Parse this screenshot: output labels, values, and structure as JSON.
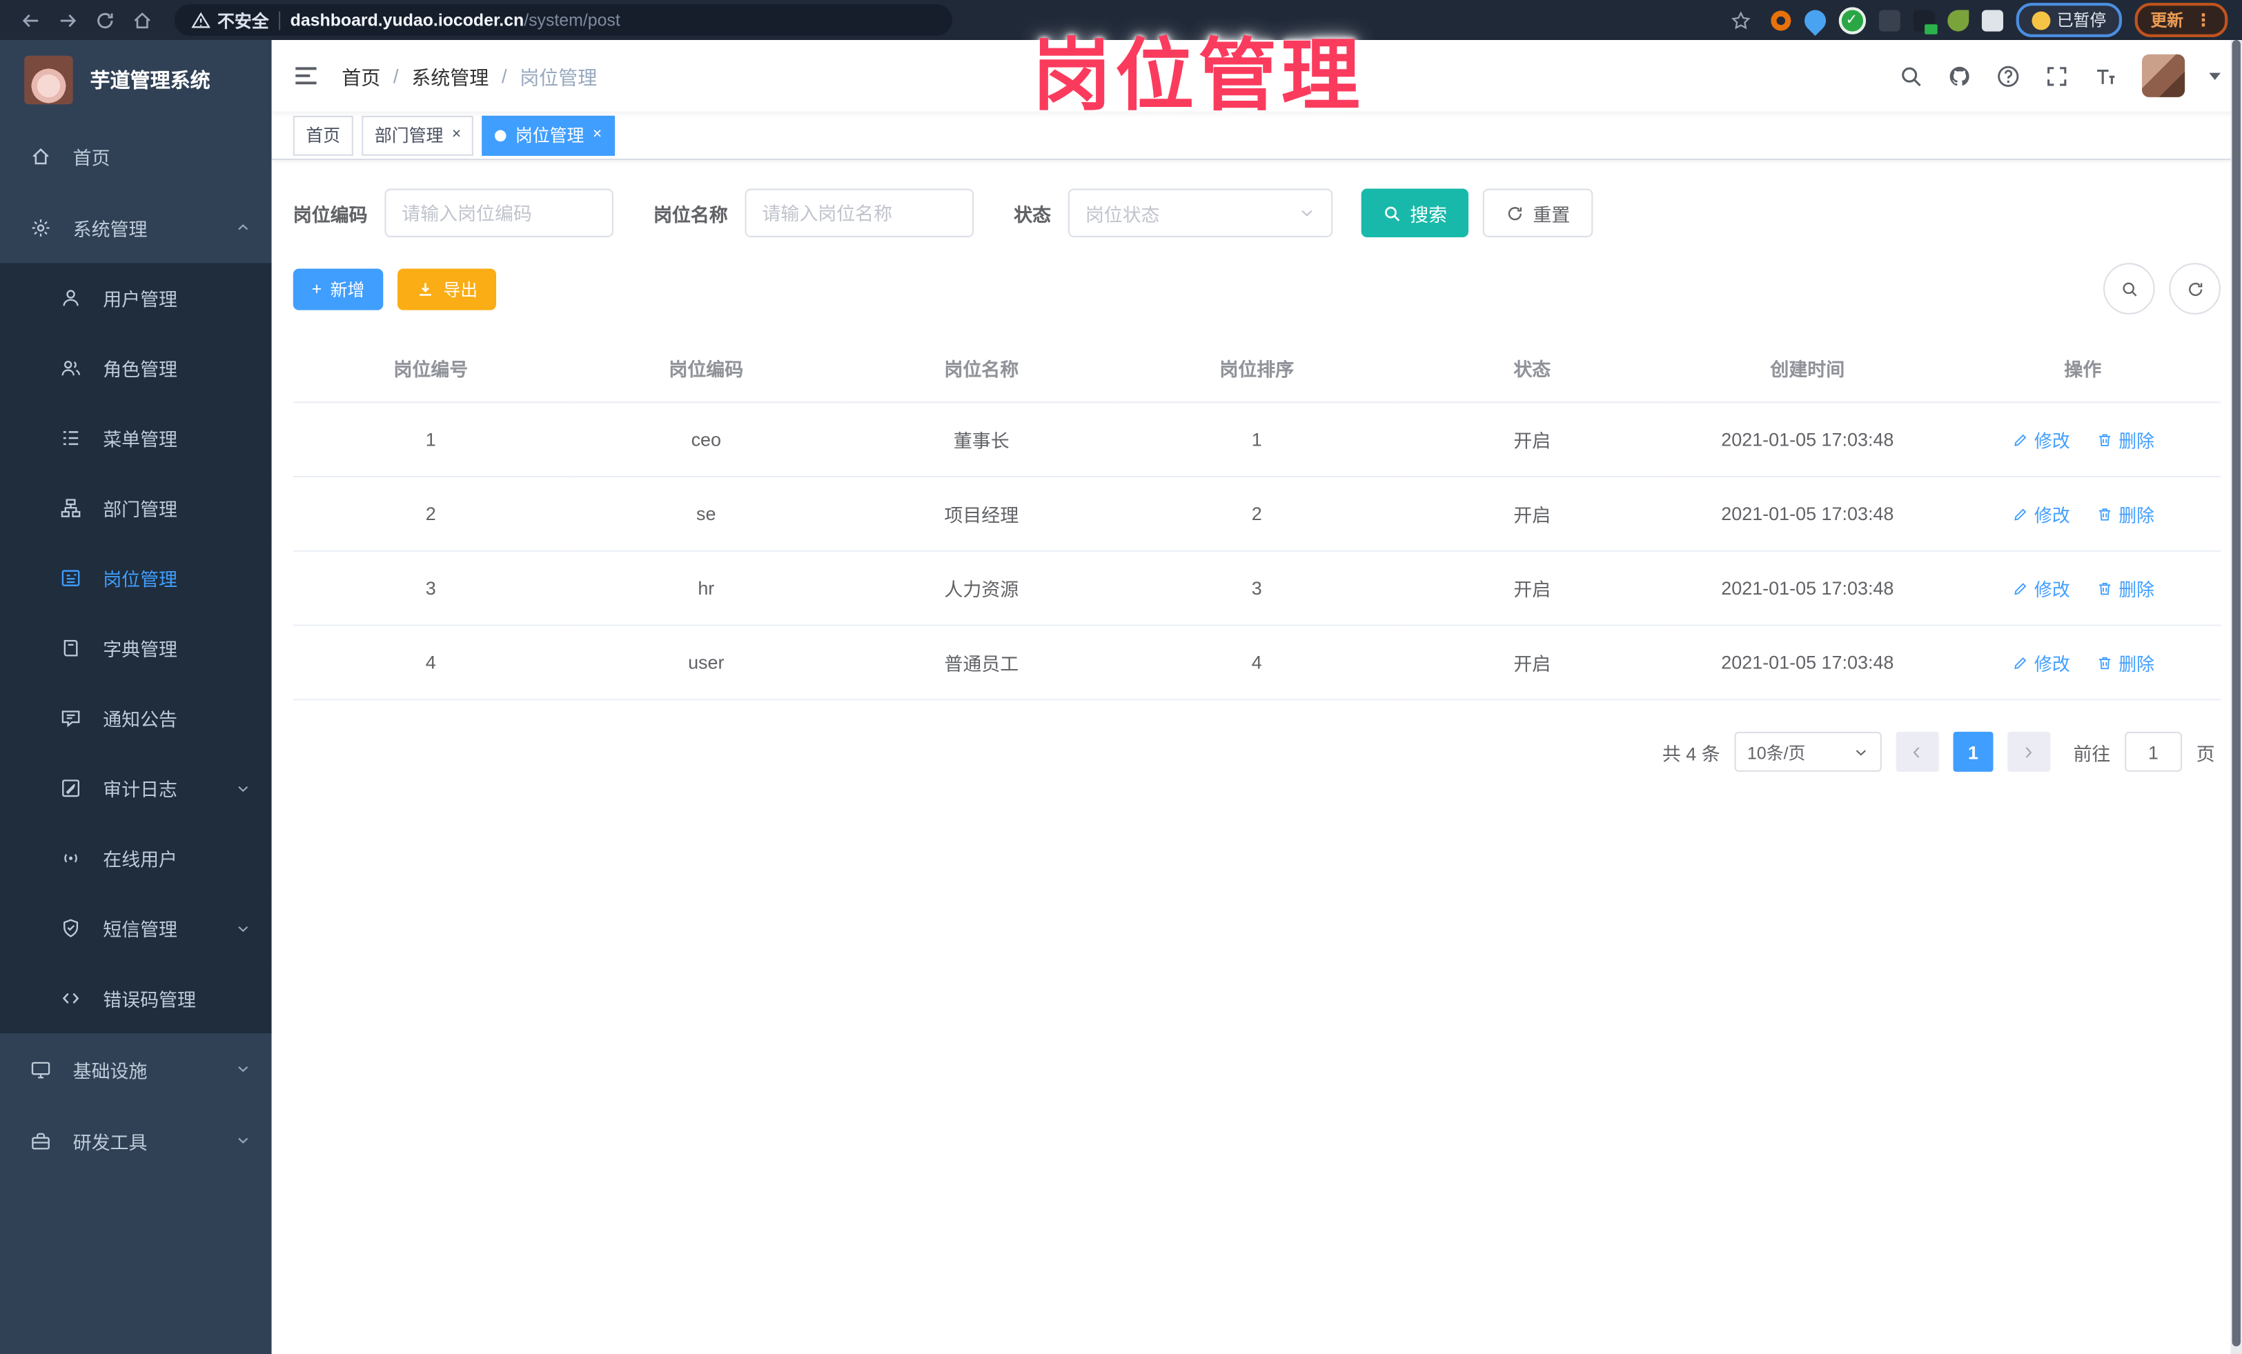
{
  "browser": {
    "security_label": "不安全",
    "url_host": "dashboard.yudao.iocoder.cn",
    "url_path": "/system/post",
    "paused_label": "已暂停",
    "update_label": "更新",
    "kebab": "⋮",
    "extension_icons": [
      "bookmark-star",
      "orange-ring",
      "blue-pin",
      "green-check",
      "gray-sliders",
      "terminal-green",
      "green-leaf",
      "puzzle",
      "paused-smiley"
    ]
  },
  "overlay_title": "岗位管理",
  "sidebar": {
    "app_title": "芋道管理系统",
    "items": [
      {
        "label": "首页"
      },
      {
        "label": "系统管理"
      },
      {
        "label": "用户管理"
      },
      {
        "label": "角色管理"
      },
      {
        "label": "菜单管理"
      },
      {
        "label": "部门管理"
      },
      {
        "label": "岗位管理"
      },
      {
        "label": "字典管理"
      },
      {
        "label": "通知公告"
      },
      {
        "label": "审计日志"
      },
      {
        "label": "在线用户"
      },
      {
        "label": "短信管理"
      },
      {
        "label": "错误码管理"
      },
      {
        "label": "基础设施"
      },
      {
        "label": "研发工具"
      }
    ]
  },
  "breadcrumb": {
    "items": [
      "首页",
      "系统管理",
      "岗位管理"
    ],
    "separator": "/"
  },
  "tags": [
    {
      "label": "首页"
    },
    {
      "label": "部门管理",
      "close": "×"
    },
    {
      "label": "岗位管理",
      "close": "×"
    }
  ],
  "filters": {
    "post_code_label": "岗位编码",
    "post_code_placeholder": "请输入岗位编码",
    "post_name_label": "岗位名称",
    "post_name_placeholder": "请输入岗位名称",
    "status_label": "状态",
    "status_placeholder": "岗位状态",
    "search_label": "搜索",
    "reset_label": "重置"
  },
  "toolbar": {
    "add_label": "新增",
    "add_plus": "+",
    "export_label": "导出"
  },
  "table": {
    "columns": [
      "岗位编号",
      "岗位编码",
      "岗位名称",
      "岗位排序",
      "状态",
      "创建时间",
      "操作"
    ],
    "edit_label": "修改",
    "delete_label": "删除",
    "rows": [
      {
        "no": "1",
        "code": "ceo",
        "name": "董事长",
        "sort": "1",
        "status": "开启",
        "created_at": "2021-01-05 17:03:48"
      },
      {
        "no": "2",
        "code": "se",
        "name": "项目经理",
        "sort": "2",
        "status": "开启",
        "created_at": "2021-01-05 17:03:48"
      },
      {
        "no": "3",
        "code": "hr",
        "name": "人力资源",
        "sort": "3",
        "status": "开启",
        "created_at": "2021-01-05 17:03:48"
      },
      {
        "no": "4",
        "code": "user",
        "name": "普通员工",
        "sort": "4",
        "status": "开启",
        "created_at": "2021-01-05 17:03:48"
      }
    ]
  },
  "pagination": {
    "total_label": "共 4 条",
    "page_size": "10条/页",
    "current_page": "1",
    "goto_label": "前往",
    "goto_value": "1",
    "page_suffix": "页"
  },
  "colors": {
    "accent_blue": "#409EFF",
    "teal": "#18B9AA",
    "warning_orange": "#FAAD14",
    "title_pink": "#FB3B5D",
    "sidebar_bg": "#304156",
    "submenu_bg": "#1F2D3D",
    "browser_bar_bg": "#202938"
  }
}
